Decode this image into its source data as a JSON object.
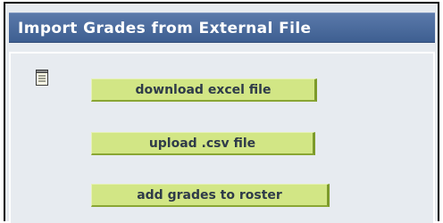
{
  "panel": {
    "title": "Import Grades from External File"
  },
  "icons": {
    "notes": "notepad-icon"
  },
  "actions": {
    "download_label": "download excel file",
    "upload_label": "upload .csv file",
    "add_label": "add grades to roster"
  },
  "colors": {
    "header_bg": "#3e5f91",
    "body_bg": "#e7ebf0",
    "button_bg": "#d2e685",
    "button_border": "#7c9a2a",
    "button_text": "#2f3b49"
  }
}
